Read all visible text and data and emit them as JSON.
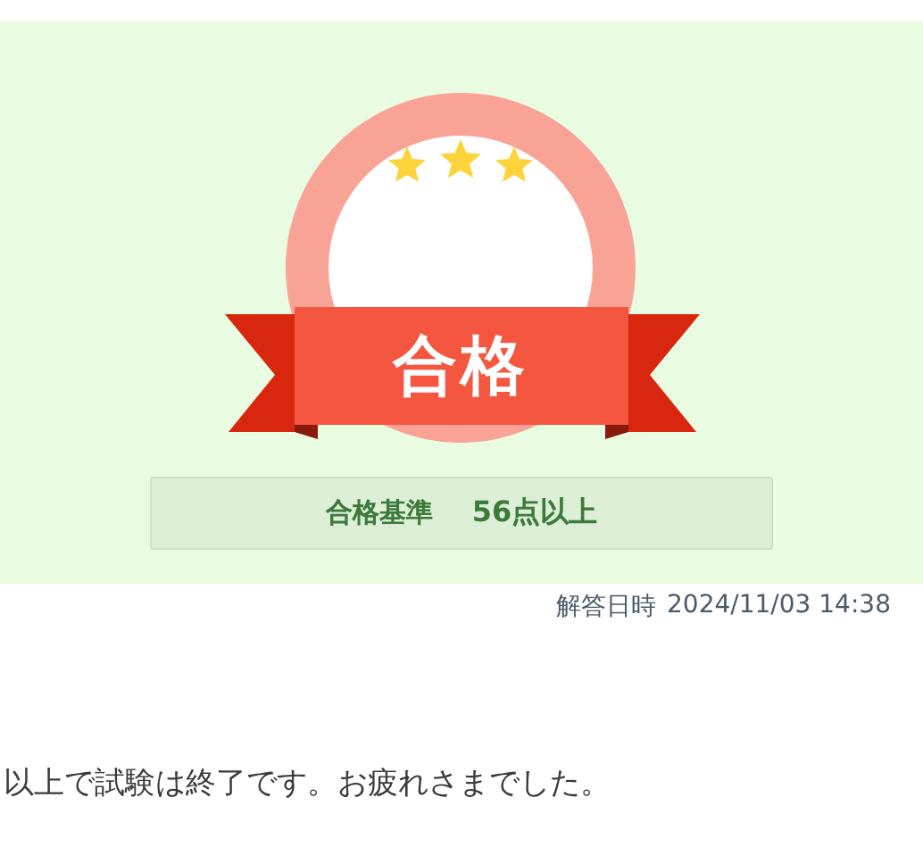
{
  "result": {
    "label": "合格",
    "stars": 3
  },
  "criterion": {
    "label": "合格基準",
    "value": "56点以上"
  },
  "answered_at": {
    "label": "解答日時",
    "value": "2024/11/03 14:38"
  },
  "message": "以上で試験は終了です。お疲れさまでした。"
}
